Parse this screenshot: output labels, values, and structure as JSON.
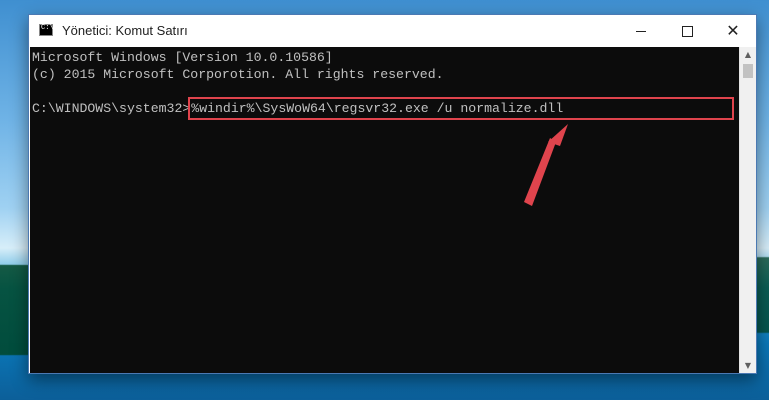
{
  "window": {
    "title": "Yönetici: Komut Satırı",
    "controls": {
      "minimize": "minimize",
      "maximize": "maximize",
      "close": "✕"
    }
  },
  "console": {
    "lines": [
      "Microsoft Windows [Version 10.0.10586]",
      "(c) 2015 Microsoft Corporotion. All rights reserved.",
      ""
    ],
    "prompt": "C:\\WINDOWS\\system32>",
    "command": "%windir%\\SysWoW64\\regsvr32.exe /u normalize.dll"
  },
  "annotation": {
    "highlight_color": "#e0444d",
    "arrow_color": "#e0444d"
  }
}
